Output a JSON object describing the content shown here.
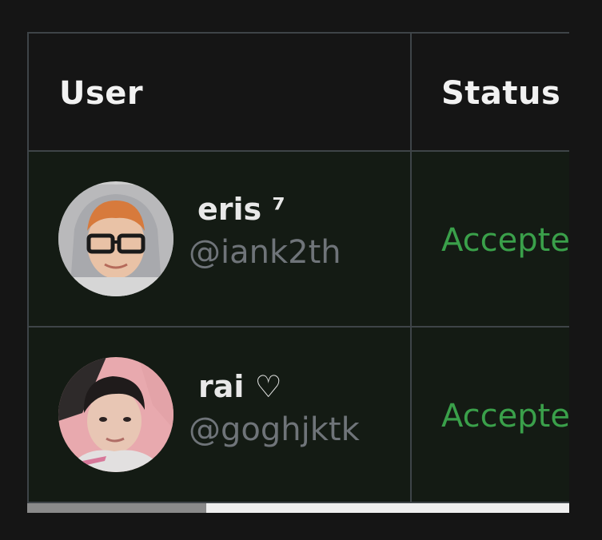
{
  "table": {
    "columns": [
      "User",
      "Status"
    ],
    "rows": [
      {
        "display_name": "eris ⁷",
        "handle": "@iank2th",
        "status": "Accepted",
        "avatar": "avatar-photo-hooded-glasses"
      },
      {
        "display_name": "rai ♡",
        "handle": "@goghjktk",
        "status": "Accepted",
        "avatar": "avatar-photo-person"
      }
    ]
  },
  "scrollbar": {
    "thumb_fraction": 0.33
  },
  "colors": {
    "background": "#151515",
    "row_background": "#141b14",
    "border": "#3e4448",
    "status_accepted": "#3aa04a",
    "handle_text": "#6f7479"
  }
}
